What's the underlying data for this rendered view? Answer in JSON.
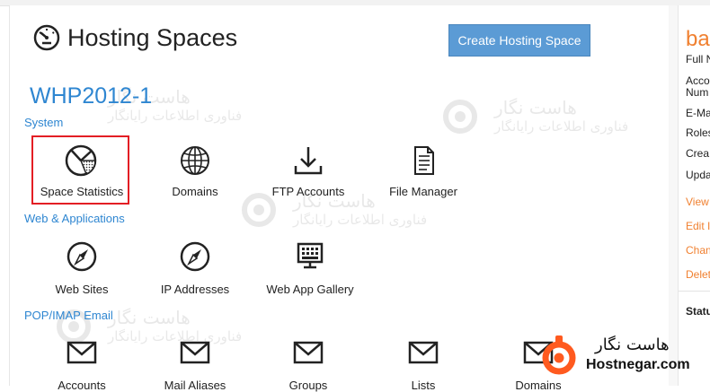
{
  "header": {
    "title": "Hosting Spaces",
    "title_icon": "gauge-icon",
    "create_button": "Create Hosting Space"
  },
  "space": {
    "name": "WHP2012-1"
  },
  "sections": {
    "system": {
      "label": "System",
      "items": [
        {
          "label": "Space Statistics",
          "icon": "pie-chart-icon"
        },
        {
          "label": "Domains",
          "icon": "globe-icon"
        },
        {
          "label": "FTP Accounts",
          "icon": "download-icon"
        },
        {
          "label": "File Manager",
          "icon": "document-icon"
        }
      ]
    },
    "web": {
      "label": "Web & Applications",
      "items": [
        {
          "label": "Web Sites",
          "icon": "compass-icon"
        },
        {
          "label": "IP Addresses",
          "icon": "compass-icon"
        },
        {
          "label": "Web App Gallery",
          "icon": "monitor-icon"
        }
      ]
    },
    "email": {
      "label": "POP/IMAP Email",
      "items": [
        {
          "label": "Accounts",
          "icon": "envelope-icon"
        },
        {
          "label": "Mail Aliases",
          "icon": "envelope-icon"
        },
        {
          "label": "Groups",
          "icon": "envelope-icon"
        },
        {
          "label": "Lists",
          "icon": "envelope-icon"
        },
        {
          "label": "Domains",
          "icon": "envelope-icon"
        }
      ]
    }
  },
  "right_panel": {
    "title": "ba",
    "fields": [
      "Full N",
      "Acco",
      "Num",
      "E-Ma",
      "Roles",
      "Crea",
      "Upda"
    ],
    "links": [
      "View",
      "Edit I",
      "Chan",
      "Delet"
    ],
    "status_label": "Statu"
  },
  "watermark": {
    "line1": "هاست نگار",
    "line2": "فناوری اطلاعات رایانگار"
  },
  "brand": {
    "persian": "هاست نگار",
    "domain": "Hostnegar.com",
    "accent": "#ff5a1f"
  },
  "colors": {
    "accent_blue": "#2e86d1",
    "button_blue": "#5b9bd5",
    "orange": "#f08030",
    "highlight_red": "#e31e24"
  }
}
